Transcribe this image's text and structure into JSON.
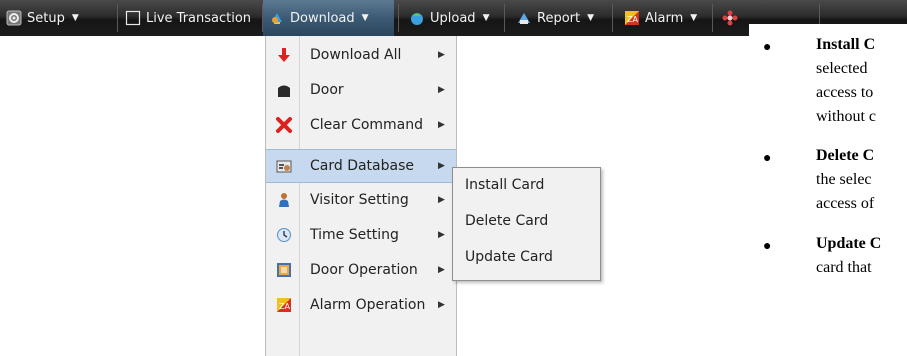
{
  "menubar": {
    "items": [
      {
        "label": "Setup",
        "icon": "gear-icon"
      },
      {
        "label": "Live Transaction",
        "icon": "window-icon"
      },
      {
        "label": "Download",
        "icon": "download-icon"
      },
      {
        "label": "Upload",
        "icon": "upload-icon"
      },
      {
        "label": "Report",
        "icon": "report-icon"
      },
      {
        "label": "Alarm",
        "icon": "alarm-icon"
      }
    ]
  },
  "dropdown": {
    "items": [
      {
        "label": "Download All",
        "icon": "red-down-arrow-icon"
      },
      {
        "label": "Door",
        "icon": "door-icon"
      },
      {
        "label": "Clear Command",
        "icon": "red-x-icon"
      },
      {
        "label": "Card Database",
        "icon": "card-database-icon"
      },
      {
        "label": "Visitor Setting",
        "icon": "visitor-icon"
      },
      {
        "label": "Time Setting",
        "icon": "clock-icon"
      },
      {
        "label": "Door Operation",
        "icon": "door-operation-icon"
      },
      {
        "label": "Alarm Operation",
        "icon": "alarm-operation-icon"
      }
    ],
    "highlighted": "Card Database"
  },
  "submenu": {
    "items": [
      {
        "label": "Install Card"
      },
      {
        "label": "Delete Card"
      },
      {
        "label": "Update Card"
      }
    ]
  },
  "doc": {
    "bullets": [
      {
        "lines": [
          "Install C",
          "selected",
          "access to",
          "without c"
        ]
      },
      {
        "lines": [
          "Delete C",
          "the selec",
          "access of"
        ]
      },
      {
        "lines": [
          "Update C",
          "card that"
        ]
      }
    ]
  },
  "colors": {
    "menubar_bg": "#1f1f1f",
    "menu_active": "#3d5a74",
    "dropdown_bg": "#f1f1f1",
    "highlight": "#c7d9ef"
  }
}
